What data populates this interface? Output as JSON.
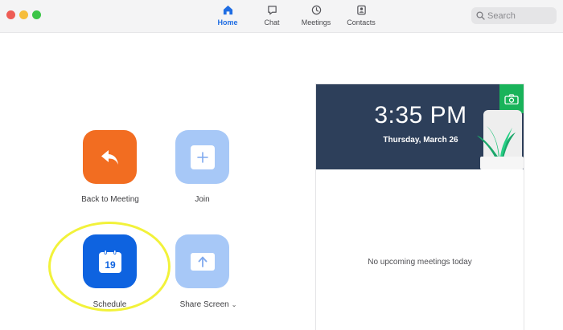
{
  "toolbar": {
    "tabs": [
      {
        "label": "Home",
        "icon": "home-icon",
        "active": true
      },
      {
        "label": "Chat",
        "icon": "chat-icon",
        "active": false
      },
      {
        "label": "Meetings",
        "icon": "clock-icon",
        "active": false
      },
      {
        "label": "Contacts",
        "icon": "contacts-icon",
        "active": false
      }
    ],
    "search": {
      "placeholder": "Search",
      "icon": "search-icon"
    }
  },
  "actions": [
    {
      "label": "Back to Meeting",
      "icon": "back-arrow-icon",
      "color": "#f26d21"
    },
    {
      "label": "Join",
      "icon": "plus-icon",
      "color": "#a7c8f7"
    },
    {
      "label": "Schedule",
      "icon": "calendar-icon",
      "day": "19",
      "color": "#0e63e0"
    },
    {
      "label": "Share Screen",
      "icon": "share-arrow-icon",
      "dropdown": "⌄",
      "color": "#a7c8f7"
    }
  ],
  "calendar_card": {
    "time": "3:35 PM",
    "date": "Thursday, March 26",
    "empty_message": "No upcoming meetings today",
    "banner_color": "#2d3f5a",
    "corner_icon": "camera-icon"
  },
  "colors": {
    "accent": "#1f6de3",
    "highlight": "#f2f23a"
  }
}
